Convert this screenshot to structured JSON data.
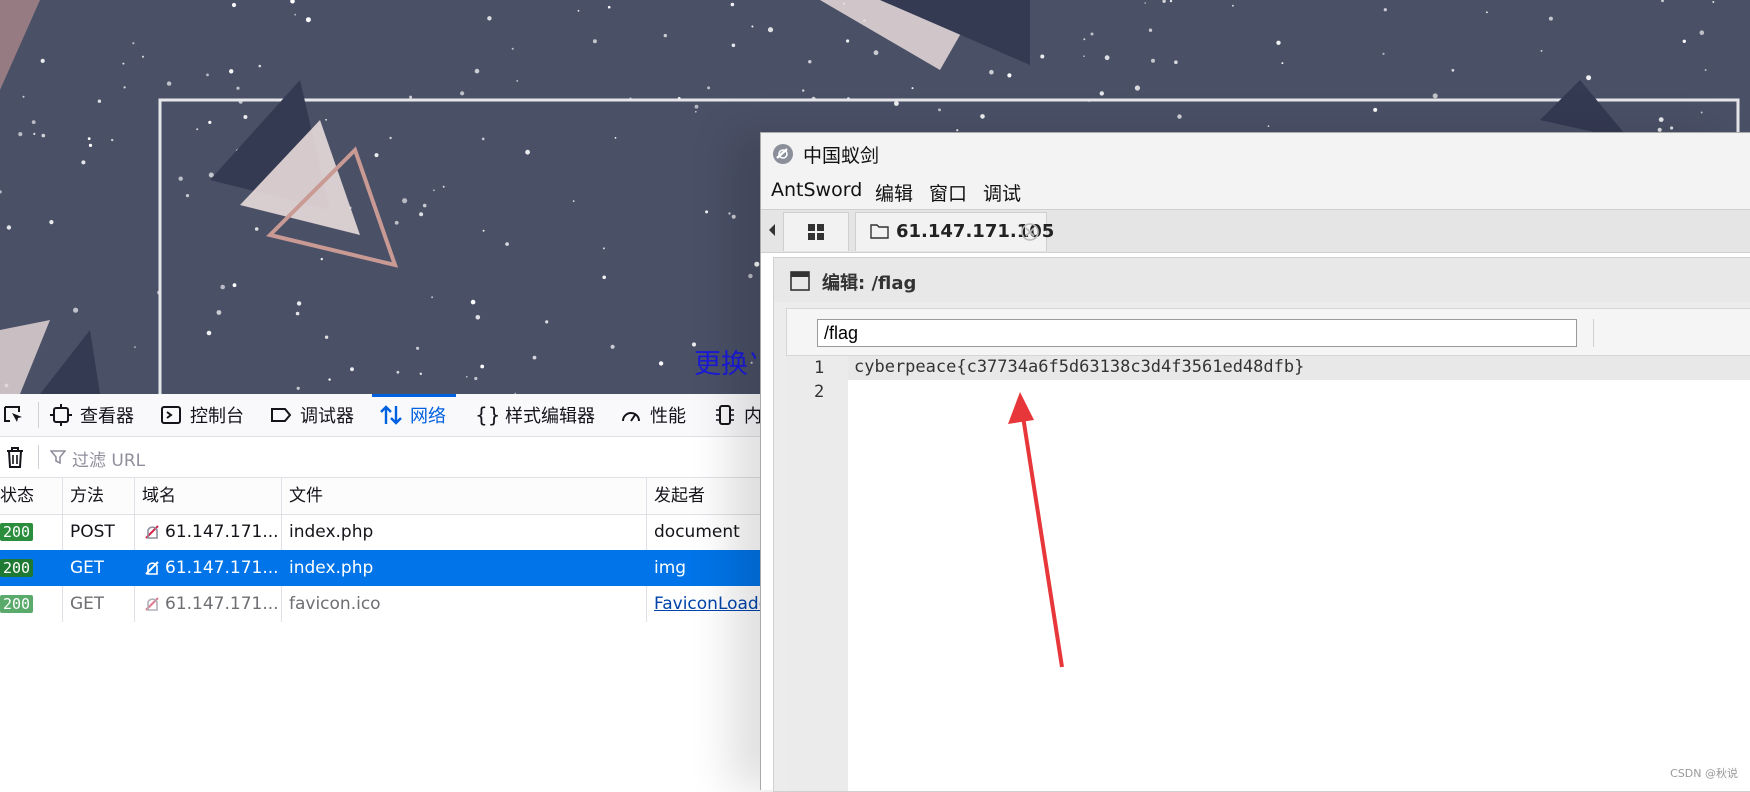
{
  "background_page": {
    "change_theme_text": "更换⺌"
  },
  "devtools": {
    "tabs": [
      {
        "label": "查看器",
        "icon": "inspector-icon"
      },
      {
        "label": "控制台",
        "icon": "console-icon"
      },
      {
        "label": "调试器",
        "icon": "debugger-icon"
      },
      {
        "label": "网络",
        "icon": "network-icon",
        "active": true
      },
      {
        "label": "样式编辑器",
        "icon": "style-editor-icon"
      },
      {
        "label": "性能",
        "icon": "performance-icon"
      },
      {
        "label": "内",
        "icon": "memory-icon"
      }
    ],
    "filter_placeholder": "过滤 URL",
    "columns": [
      "状态",
      "方法",
      "域名",
      "文件",
      "发起者"
    ],
    "rows": [
      {
        "status": "200",
        "method": "POST",
        "domain": "61.147.171....",
        "file": "index.php",
        "initiator": "document"
      },
      {
        "status": "200",
        "method": "GET",
        "domain": "61.147.171....",
        "file": "index.php",
        "initiator": "img",
        "selected": true
      },
      {
        "status": "200",
        "method": "GET",
        "domain": "61.147.171....",
        "file": "favicon.ico",
        "initiator": "FaviconLoade"
      }
    ]
  },
  "antsword": {
    "title": "中国蚁剑",
    "menu": [
      "AntSword",
      "编辑",
      "窗口",
      "调试"
    ],
    "tab_host": "61.147.171.105",
    "panel_title": "编辑: /flag",
    "path_value": "/flag",
    "line_numbers": [
      "1",
      "2"
    ],
    "code_lines": [
      "cyberpeace{c37734a6f5d63138c3d4f3561ed48dfb}",
      ""
    ]
  },
  "watermark": "CSDN @秋说",
  "colors": {
    "bg_sky": "#4a5066",
    "network_active": "#0061e0",
    "selected_row": "#0074e8",
    "status_ok": "#2a8e3d",
    "arrow": "#e8373a"
  }
}
